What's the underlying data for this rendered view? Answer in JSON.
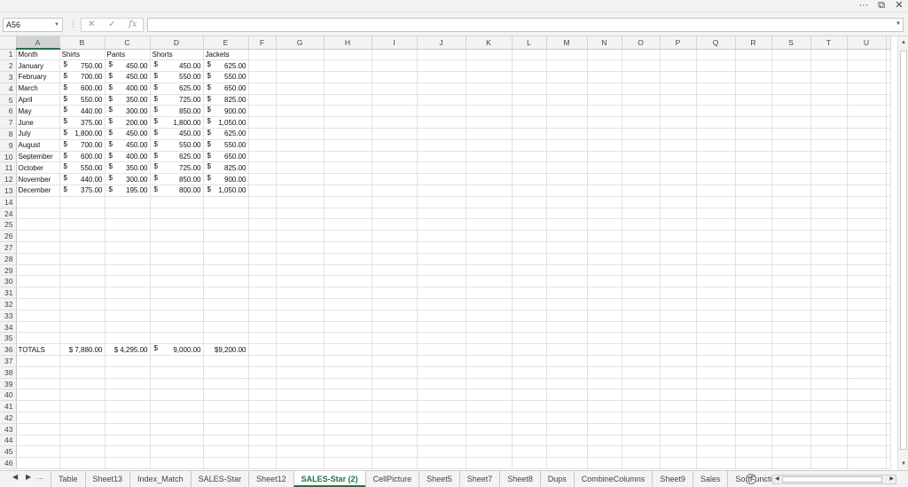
{
  "window": {
    "more_label": "···",
    "restore_label": "⧉",
    "close_label": "✕"
  },
  "formula_bar": {
    "name_box": "A56",
    "separator": "⋮",
    "cancel_icon": "✕",
    "enter_icon": "✓",
    "fx_label": "fx",
    "formula_value": ""
  },
  "columns": [
    "A",
    "B",
    "C",
    "D",
    "E",
    "F",
    "G",
    "H",
    "I",
    "J",
    "K",
    "L",
    "M",
    "N",
    "O",
    "P",
    "Q",
    "R",
    "S",
    "T",
    "U"
  ],
  "selected_column": "A",
  "rows": [
    {
      "n": "1",
      "a": "Month",
      "b": "Shirts",
      "c": "Pants",
      "d": "Shorts",
      "e": "Jackets",
      "header": true
    },
    {
      "n": "2",
      "a": "January",
      "b": "750.00",
      "c": "450.00",
      "d": "450.00",
      "e": "625.00"
    },
    {
      "n": "3",
      "a": "February",
      "b": "700.00",
      "c": "450.00",
      "d": "550.00",
      "e": "550.00"
    },
    {
      "n": "4",
      "a": "March",
      "b": "600.00",
      "c": "400.00",
      "d": "625.00",
      "e": "650.00"
    },
    {
      "n": "5",
      "a": "April",
      "b": "550.00",
      "c": "350.00",
      "d": "725.00",
      "e": "825.00"
    },
    {
      "n": "6",
      "a": "May",
      "b": "440.00",
      "c": "300.00",
      "d": "850.00",
      "e": "900.00"
    },
    {
      "n": "7",
      "a": "June",
      "b": "375.00",
      "c": "200.00",
      "d": "1,800.00",
      "e": "1,050.00"
    },
    {
      "n": "8",
      "a": "July",
      "b": "1,800.00",
      "c": "450.00",
      "d": "450.00",
      "e": "625.00"
    },
    {
      "n": "9",
      "a": "August",
      "b": "700.00",
      "c": "450.00",
      "d": "550.00",
      "e": "550.00"
    },
    {
      "n": "10",
      "a": "September",
      "b": "600.00",
      "c": "400.00",
      "d": "625.00",
      "e": "650.00"
    },
    {
      "n": "11",
      "a": "October",
      "b": "550.00",
      "c": "350.00",
      "d": "725.00",
      "e": "825.00"
    },
    {
      "n": "12",
      "a": "November",
      "b": "440.00",
      "c": "300.00",
      "d": "850.00",
      "e": "900.00"
    },
    {
      "n": "13",
      "a": "December",
      "b": "375.00",
      "c": "195.00",
      "d": "800.00",
      "e": "1,050.00"
    },
    {
      "n": "14"
    },
    {
      "n": "24"
    },
    {
      "n": "25"
    },
    {
      "n": "26"
    },
    {
      "n": "27"
    },
    {
      "n": "28"
    },
    {
      "n": "29"
    },
    {
      "n": "30"
    },
    {
      "n": "31"
    },
    {
      "n": "32"
    },
    {
      "n": "33"
    },
    {
      "n": "34"
    },
    {
      "n": "35"
    },
    {
      "n": "36",
      "a": "TOTALS",
      "b": "$ 7,880.00",
      "c": "$ 4,295.00",
      "d": "9,000.00",
      "e": "$9,200.00",
      "totals": true
    },
    {
      "n": "37"
    },
    {
      "n": "38"
    },
    {
      "n": "39"
    },
    {
      "n": "40"
    },
    {
      "n": "41"
    },
    {
      "n": "42"
    },
    {
      "n": "43"
    },
    {
      "n": "44"
    },
    {
      "n": "45"
    },
    {
      "n": "46"
    }
  ],
  "currency_symbol": "$",
  "sheet_tabs": {
    "nav_prev": "◀",
    "nav_next": "▶",
    "nav_more": "...",
    "tabs": [
      "Table",
      "Sheet13",
      "Index_Match",
      "SALES-Star",
      "Sheet12",
      "SALES-Star (2)",
      "CellPicture",
      "Sheet5",
      "Sheet7",
      "Sheet8",
      "Dups",
      "CombineColumns",
      "Sheet9",
      "Sales",
      "SortFuncti ..."
    ],
    "active_tab": "SALES-Star (2)",
    "add_label": "+",
    "dots": "⋮"
  }
}
